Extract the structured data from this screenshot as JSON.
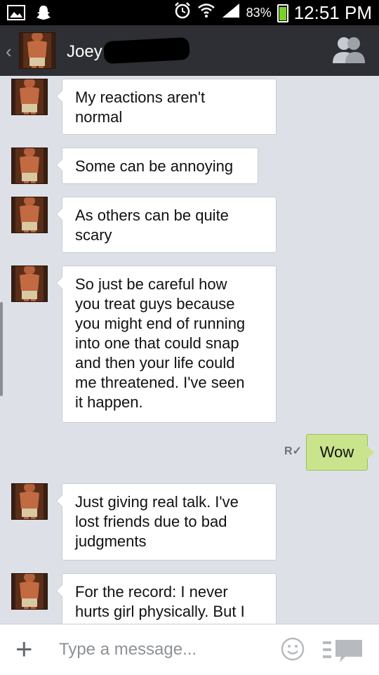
{
  "status_bar": {
    "battery_percent": "83%",
    "battery_level": 0.83,
    "time": "12:51 PM",
    "icons": [
      "image-icon",
      "snapchat-icon",
      "alarm-icon",
      "wifi-icon",
      "signal-icon",
      "battery-icon"
    ]
  },
  "header": {
    "contact_name": "Joey",
    "name_suffix": "/",
    "back_glyph": "‹",
    "icons": [
      "back-arrow-icon",
      "contact-avatar",
      "friends-icon"
    ]
  },
  "messages": [
    {
      "direction": "received",
      "lines": [
        "My reactions aren't",
        "normal"
      ]
    },
    {
      "direction": "received",
      "lines": [
        "Some can be annoying"
      ]
    },
    {
      "direction": "received",
      "lines": [
        "As others can be quite",
        "scary"
      ]
    },
    {
      "direction": "received",
      "lines": [
        "So just be careful how",
        "you treat guys because",
        "you might end of running",
        "into one that could snap",
        "and then your life could",
        "me threatened. I've seen",
        "it happen."
      ]
    },
    {
      "direction": "sent",
      "text": "Wow",
      "read_marker": "R"
    },
    {
      "direction": "received",
      "lines": [
        "Just giving real talk. I've",
        "lost friends due to bad",
        "judgments"
      ]
    },
    {
      "direction": "received",
      "lines": [
        "For the record: I never",
        "hurts girl physically. But I"
      ]
    }
  ],
  "input_bar": {
    "placeholder": "Type a message...",
    "plus_glyph": "+",
    "icons": [
      "plus-icon",
      "emoji-icon",
      "chat-list-icon"
    ]
  },
  "colors": {
    "chat_background": "#dde0e7",
    "header_background": "#2d2f34",
    "sent_bubble": "#c9e48c",
    "received_bubble": "#ffffff",
    "battery_fill": "#7bd02a"
  }
}
